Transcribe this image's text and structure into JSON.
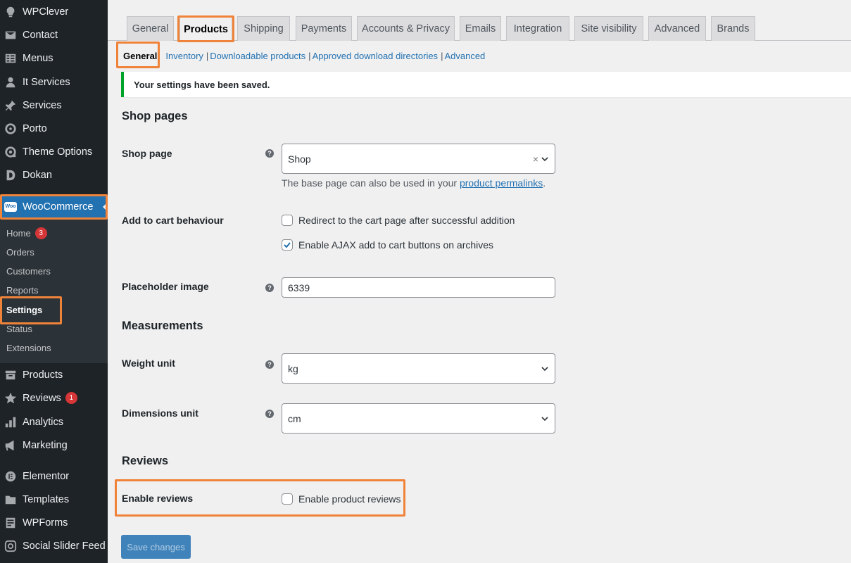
{
  "sidebar": {
    "items": [
      {
        "label": "WPClever",
        "icon": "bulb-icon"
      },
      {
        "label": "Contact",
        "icon": "envelope-icon"
      },
      {
        "label": "Menus",
        "icon": "menus-icon"
      },
      {
        "label": "It Services",
        "icon": "person-icon"
      },
      {
        "label": "Services",
        "icon": "pin-icon"
      },
      {
        "label": "Porto",
        "icon": "circle-icon"
      },
      {
        "label": "Theme Options",
        "icon": "gear-circle-icon"
      },
      {
        "label": "Dokan",
        "icon": "dokan-icon"
      },
      {
        "label": "WooCommerce",
        "icon": "woo-icon"
      },
      {
        "label": "Products",
        "icon": "archive-icon"
      },
      {
        "label": "Reviews",
        "icon": "star-icon",
        "badge": "1"
      },
      {
        "label": "Analytics",
        "icon": "bar-chart-icon"
      },
      {
        "label": "Marketing",
        "icon": "megaphone-icon"
      },
      {
        "label": "Elementor",
        "icon": "elementor-icon"
      },
      {
        "label": "Templates",
        "icon": "folder-icon"
      },
      {
        "label": "WPForms",
        "icon": "forms-icon"
      },
      {
        "label": "Social Slider Feed",
        "icon": "instagram-icon"
      }
    ],
    "woo_logo_text": "Woo",
    "submenu": [
      {
        "label": "Home",
        "badge": "3"
      },
      {
        "label": "Orders"
      },
      {
        "label": "Customers"
      },
      {
        "label": "Reports"
      },
      {
        "label": "Settings"
      },
      {
        "label": "Status"
      },
      {
        "label": "Extensions"
      }
    ]
  },
  "tabs": [
    "General",
    "Products",
    "Shipping",
    "Payments",
    "Accounts & Privacy",
    "Emails",
    "Integration",
    "Site visibility",
    "Advanced",
    "Brands"
  ],
  "subnav": [
    "General",
    "Inventory",
    "Downloadable products",
    "Approved download directories",
    "Advanced"
  ],
  "subnav_separator": "|",
  "notice": "Your settings have been saved.",
  "sections": {
    "shop_pages": "Shop pages",
    "measurements": "Measurements",
    "reviews": "Reviews"
  },
  "fields": {
    "shop_page_label": "Shop page",
    "shop_page_value": "Shop",
    "shop_page_clear": "×",
    "shop_page_desc_pre": "The base page can also be used in your ",
    "shop_page_desc_link": "product permalinks",
    "shop_page_desc_post": ".",
    "add_to_cart_label": "Add to cart behaviour",
    "redirect_label": "Redirect to the cart page after successful addition",
    "ajax_label": "Enable AJAX add to cart buttons on archives",
    "placeholder_label": "Placeholder image",
    "placeholder_value": "6339",
    "weight_label": "Weight unit",
    "weight_value": "kg",
    "dimensions_label": "Dimensions unit",
    "dimensions_value": "cm",
    "enable_reviews_label": "Enable reviews",
    "enable_product_reviews": "Enable product reviews",
    "help_glyph": "?"
  },
  "checkboxes": {
    "redirect": false,
    "ajax": true,
    "enable_product_reviews": false
  },
  "save_button": "Save changes",
  "colors": {
    "sidebar_bg": "#1d2327",
    "accent": "#2271b1",
    "highlight": "#f0833a",
    "notice_border": "#00a32a",
    "badge": "#d63638"
  }
}
